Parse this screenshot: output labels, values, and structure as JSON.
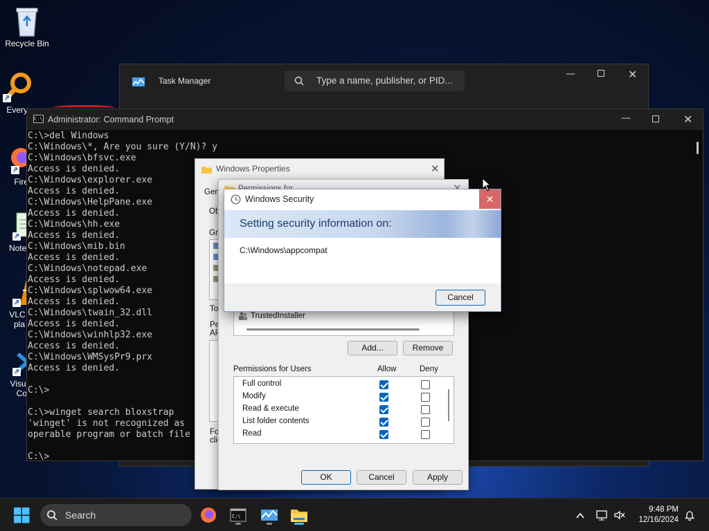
{
  "desktop": {
    "icons": [
      {
        "label": "Recycle Bin"
      },
      {
        "label": "Every"
      },
      {
        "label": "Fire"
      },
      {
        "label": "Notep"
      },
      {
        "label": "VLC m",
        "label2": "pla"
      },
      {
        "label": "Visual",
        "label2": "Co"
      }
    ]
  },
  "task_manager": {
    "title": "Task Manager",
    "search_placeholder": "Type a name, publisher, or PID..."
  },
  "cmd": {
    "title": "Administrator: Command Prompt",
    "lines": [
      "C:\\>del Windows",
      "C:\\Windows\\*, Are you sure (Y/N)? y",
      "C:\\Windows\\bfsvc.exe",
      "Access is denied.",
      "C:\\Windows\\explorer.exe",
      "Access is denied.",
      "C:\\Windows\\HelpPane.exe",
      "Access is denied.",
      "C:\\Windows\\hh.exe",
      "Access is denied.",
      "C:\\Windows\\mib.bin",
      "Access is denied.",
      "C:\\Windows\\notepad.exe",
      "Access is denied.",
      "C:\\Windows\\splwow64.exe",
      "Access is denied.",
      "C:\\Windows\\twain_32.dll",
      "Access is denied.",
      "C:\\Windows\\winhlp32.exe",
      "Access is denied.",
      "C:\\Windows\\WMSysPr9.prx",
      "Access is denied.",
      "",
      "C:\\>",
      "",
      "C:\\>winget search bloxstrap",
      "'winget' is not recognized as",
      "operable program or batch file",
      "",
      "C:\\>"
    ]
  },
  "properties": {
    "title": "Windows Properties",
    "frag_tab": "Gen",
    "frag_obj": "Ob",
    "frag_gr": "Gr",
    "frag_to": "To",
    "frag_pe": "Pe",
    "frag_ap": "AP",
    "frag_fo": "Fo",
    "frag_cli": "clic"
  },
  "permissions": {
    "title_fragment": "Permissions for Windows",
    "principal": "TrustedInstaller",
    "add_label": "Add...",
    "remove_label": "Remove",
    "perm_header": "Permissions for Users",
    "allow_header": "Allow",
    "deny_header": "Deny",
    "rows": [
      {
        "name": "Full control",
        "allow": true,
        "deny": false
      },
      {
        "name": "Modify",
        "allow": true,
        "deny": false
      },
      {
        "name": "Read & execute",
        "allow": true,
        "deny": false
      },
      {
        "name": "List folder contents",
        "allow": true,
        "deny": false
      },
      {
        "name": "Read",
        "allow": true,
        "deny": false
      }
    ],
    "ok_label": "OK",
    "cancel_label": "Cancel",
    "apply_label": "Apply"
  },
  "security": {
    "title": "Windows Security",
    "heading": "Setting security information on:",
    "path": "C:\\Windows\\appcompat",
    "cancel_label": "Cancel"
  },
  "taskbar": {
    "search_label": "Search",
    "time": "9:48 PM",
    "date": "12/16/2024"
  }
}
